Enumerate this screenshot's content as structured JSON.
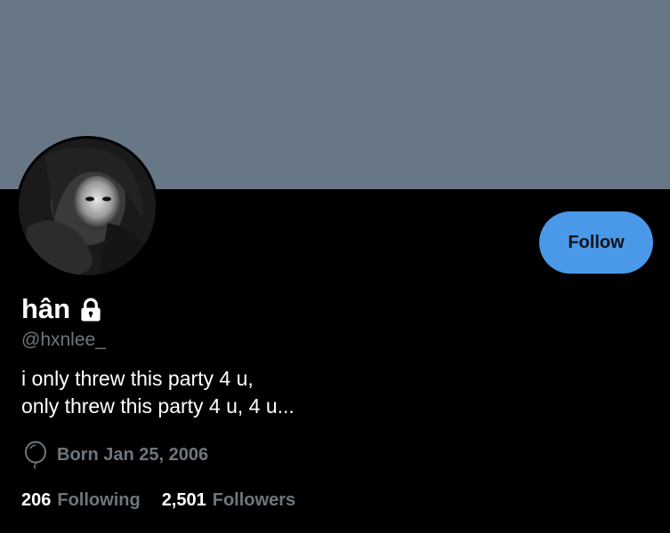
{
  "profile": {
    "display_name": "hân",
    "protected_icon": "lock-icon",
    "handle": "@hxnlee_",
    "bio_lines": [
      "i only threw this party 4 u,",
      "only threw this party 4 u, 4 u..."
    ],
    "birth_icon": "balloon-icon",
    "birth_text": "Born Jan 25, 2006"
  },
  "actions": {
    "follow_label": "Follow"
  },
  "stats": {
    "following_count": "206",
    "following_label": "Following",
    "followers_count": "2,501",
    "followers_label": "Followers"
  },
  "colors": {
    "banner": "#687785",
    "background": "#000000",
    "accent": "#4a99e9",
    "muted_text": "#6e767d"
  }
}
